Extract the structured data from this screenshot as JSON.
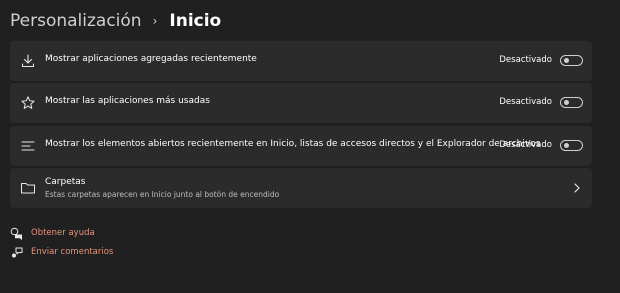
{
  "breadcrumb": {
    "parent": "Personalización",
    "separator": "›",
    "current": "Inicio"
  },
  "settings": [
    {
      "label": "Mostrar aplicaciones agregadas recientemente",
      "state": "Desactivado",
      "icon": "download-icon"
    },
    {
      "label": "Mostrar las aplicaciones más usadas",
      "state": "Desactivado",
      "icon": "star-icon"
    },
    {
      "label": "Mostrar los elementos abiertos recientemente en Inicio, listas de accesos directos y el Explorador de archivos",
      "state": "Desactivado",
      "icon": "list-lines-icon"
    }
  ],
  "folders": {
    "title": "Carpetas",
    "description": "Estas carpetas aparecen en Inicio junto al botón de encendido",
    "icon": "folder-icon"
  },
  "links": {
    "help": "Obtener ayuda",
    "feedback": "Enviar comentarios"
  },
  "colors": {
    "background": "#202020",
    "card": "#2b2b2b",
    "link": "#e8937b"
  }
}
